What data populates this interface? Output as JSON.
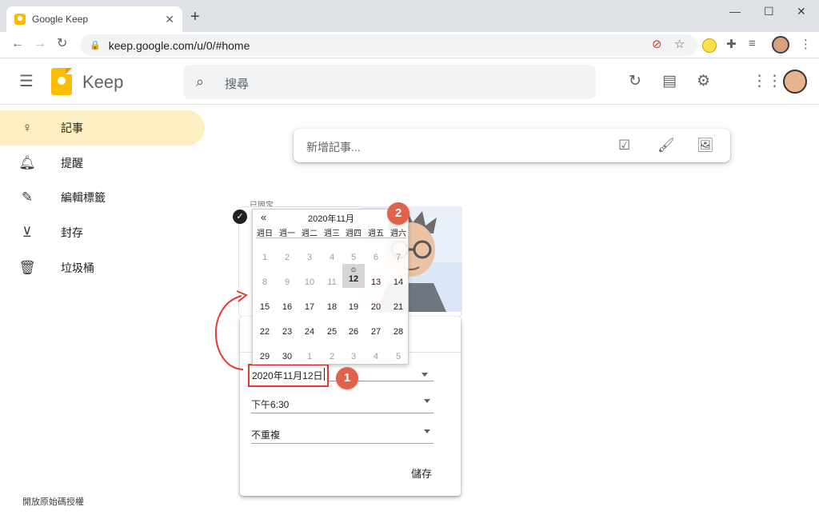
{
  "browser": {
    "tab_title": "Google Keep",
    "tab_close": "✕",
    "new_tab": "+",
    "url": "keep.google.com/u/0/#home"
  },
  "app": {
    "name": "Keep",
    "search_placeholder": "搜尋"
  },
  "sidebar": {
    "items": [
      {
        "label": "記事",
        "icon": "lightbulb-icon",
        "active": true
      },
      {
        "label": "提醒",
        "icon": "bell-icon"
      },
      {
        "label": "編輯標籤",
        "icon": "pencil-icon"
      },
      {
        "label": "封存",
        "icon": "archive-icon"
      },
      {
        "label": "垃圾桶",
        "icon": "trash-icon"
      }
    ],
    "footer_link": "開放原始碼授權"
  },
  "take_note": {
    "placeholder": "新增記事..."
  },
  "notes": {
    "pinned_label": "已固定"
  },
  "reminder_dialog": {
    "date_value": "2020年11月12日",
    "time_value": "下午6:30",
    "repeat_value": "不重複",
    "save_label": "儲存"
  },
  "calendar": {
    "prev_label": "«",
    "title": "2020年11月",
    "weekdays": [
      "週日",
      "週一",
      "週二",
      "週三",
      "週四",
      "週五",
      "週六"
    ],
    "weeks": [
      [
        "1",
        "2",
        "3",
        "4",
        "5",
        "6",
        "7"
      ],
      [
        "8",
        "9",
        "10",
        "11",
        "12",
        "13",
        "14"
      ],
      [
        "15",
        "16",
        "17",
        "18",
        "19",
        "20",
        "21"
      ],
      [
        "22",
        "23",
        "24",
        "25",
        "26",
        "27",
        "28"
      ],
      [
        "29",
        "30",
        "1",
        "2",
        "3",
        "4",
        "5"
      ]
    ],
    "selected_day": "12"
  },
  "annotations": {
    "badge_1": "1",
    "badge_2": "2",
    "highlight_color": "#e53935",
    "badge_color": "#e0624a"
  },
  "colors": {
    "keep_yellow": "#fbbc04",
    "active_nav": "#feefc3"
  }
}
